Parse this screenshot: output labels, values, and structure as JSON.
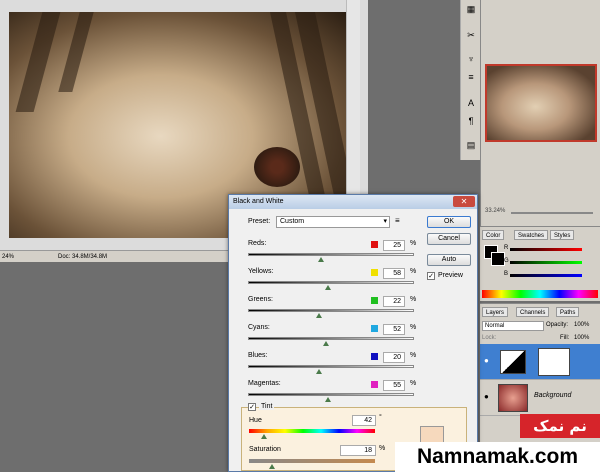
{
  "document": {
    "status_zoom": "24%",
    "status_doc": "Doc: 34.8M/34.8M"
  },
  "navigator": {
    "zoom": "33.24%"
  },
  "color_panel": {
    "tabs": [
      "Color",
      "Swatches",
      "Styles"
    ],
    "channels": [
      "R",
      "G",
      "B"
    ]
  },
  "layers_panel": {
    "tabs": [
      "Layers",
      "Channels",
      "Paths"
    ],
    "blend_mode": "Normal",
    "opacity_label": "Opacity:",
    "opacity_value": "100%",
    "fill_label": "Fill:",
    "fill_value": "100%",
    "lock_label": "Lock:",
    "background_layer": "Background"
  },
  "dialog": {
    "title": "Black and White",
    "preset_label": "Preset:",
    "preset_value": "Custom",
    "ok": "OK",
    "cancel": "Cancel",
    "auto": "Auto",
    "preview": "Preview",
    "channels": [
      {
        "label": "Reds:",
        "value": "25",
        "color": "#e01010",
        "fraction": 0.44
      },
      {
        "label": "Yellows:",
        "value": "58",
        "color": "#f0e000",
        "fraction": 0.48
      },
      {
        "label": "Greens:",
        "value": "22",
        "color": "#20c020",
        "fraction": 0.43
      },
      {
        "label": "Cyans:",
        "value": "52",
        "color": "#20a8e0",
        "fraction": 0.47
      },
      {
        "label": "Blues:",
        "value": "20",
        "color": "#1010c0",
        "fraction": 0.43
      },
      {
        "label": "Magentas:",
        "value": "55",
        "color": "#e020c0",
        "fraction": 0.48
      }
    ],
    "percent": "%",
    "tint_label": "Tint",
    "hue_label": "Hue",
    "hue_value": "42",
    "hue_unit": "°",
    "saturation_label": "Saturation",
    "saturation_value": "18",
    "tint_color": "#f6d9bd"
  },
  "watermark": {
    "arabic": "نم نمک",
    "name": "Namnamak.com"
  }
}
